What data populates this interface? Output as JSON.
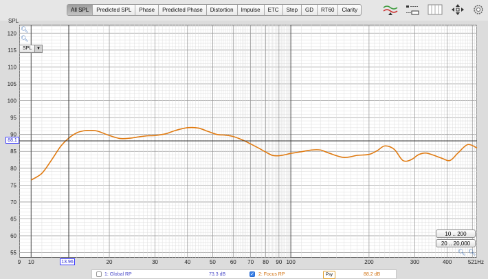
{
  "toolbar": {
    "tabs": [
      "All SPL",
      "Predicted SPL",
      "Phase",
      "Predicted Phase",
      "Distortion",
      "Impulse",
      "ETC",
      "Step",
      "GD",
      "RT60",
      "Clarity"
    ],
    "active_tab": "All SPL",
    "icons": [
      "eq-arrows-icon",
      "controls-icon",
      "layout-panels-icon",
      "move-arrows-icon",
      "settings-gear-icon"
    ]
  },
  "graph": {
    "y_axis_title": "SPL",
    "y_selector": "SPL",
    "cursor_y": "88.1",
    "cursor_x": "13.96",
    "range_buttons": [
      "10 .. 200",
      "20 .. 20,000"
    ],
    "colors": {
      "trace": "#e07a10",
      "cursor": "#3a3aff",
      "grid_major": "#9a9a9a",
      "grid_minor": "#dddddd"
    }
  },
  "legend": {
    "items": [
      {
        "label": "1: Global RP",
        "value": "73.3 dB",
        "checked": false,
        "color": "#5555cc"
      },
      {
        "label": "2: Focus RP",
        "value": "88.2 dB",
        "checked": true,
        "color": "#e07a10"
      }
    ],
    "badge": "Psy"
  },
  "chart_data": {
    "type": "line",
    "x_scale": "log",
    "xlim": [
      9,
      521
    ],
    "ylim": [
      53.5,
      122.5
    ],
    "xlabel": "",
    "ylabel": "SPL",
    "x_ticks": [
      "9",
      "10",
      "20",
      "30",
      "40",
      "50",
      "60",
      "70",
      "80",
      "90",
      "100",
      "200",
      "300",
      "400",
      "521Hz"
    ],
    "y_ticks": [
      55,
      60,
      65,
      70,
      75,
      80,
      85,
      90,
      95,
      100,
      105,
      110,
      115,
      120
    ],
    "series": [
      {
        "name": "2: Focus RP",
        "x": [
          10,
          11,
          12,
          13,
          14,
          15,
          16,
          17,
          18,
          20,
          22,
          24,
          26,
          28,
          30,
          33,
          36,
          40,
          44,
          48,
          52,
          56,
          60,
          65,
          70,
          75,
          80,
          85,
          90,
          95,
          100,
          110,
          120,
          130,
          140,
          160,
          180,
          200,
          215,
          230,
          250,
          270,
          290,
          310,
          330,
          350,
          380,
          410,
          440,
          480,
          521
        ],
        "values": [
          76.5,
          78.5,
          82.5,
          86.5,
          89,
          90.5,
          91.1,
          91.2,
          91.0,
          89.7,
          88.8,
          88.9,
          89.3,
          89.6,
          89.7,
          90.2,
          91.2,
          92.0,
          91.9,
          90.9,
          90.0,
          89.8,
          89.4,
          88.4,
          87.2,
          86.0,
          84.8,
          83.8,
          83.7,
          84.0,
          84.4,
          84.9,
          85.4,
          85.4,
          84.5,
          83.2,
          83.8,
          84.1,
          85.2,
          86.6,
          85.6,
          82.3,
          82.5,
          84.0,
          84.5,
          84.0,
          83.0,
          82.3,
          84.5,
          87.0,
          86.0
        ]
      }
    ],
    "grid": true,
    "cursor": {
      "x": 13.96,
      "y": 88.1
    }
  }
}
